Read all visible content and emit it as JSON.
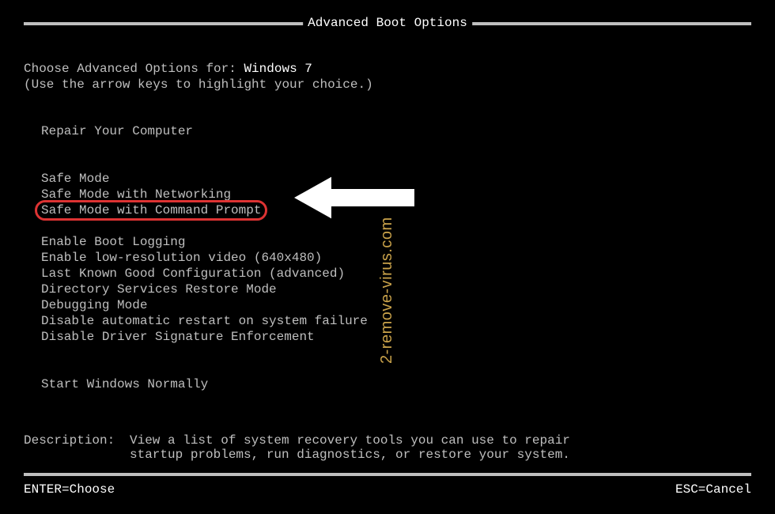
{
  "title": "Advanced Boot Options",
  "choose": {
    "label": "Choose Advanced Options for: ",
    "value": "Windows 7"
  },
  "hint": "(Use the arrow keys to highlight your choice.)",
  "menu": {
    "repair": "Repair Your Computer",
    "group1": {
      "safe_mode": "Safe Mode",
      "safe_net": "Safe Mode with Networking",
      "safe_cmd": "Safe Mode with Command Prompt"
    },
    "group2": {
      "boot_log": "Enable Boot Logging",
      "low_res": "Enable low-resolution video (640x480)",
      "lkgc": "Last Known Good Configuration (advanced)",
      "dsrm": "Directory Services Restore Mode",
      "debug": "Debugging Mode",
      "no_auto_restart": "Disable automatic restart on system failure",
      "no_driver_sig": "Disable Driver Signature Enforcement"
    },
    "start_normal": "Start Windows Normally"
  },
  "selected_item": "safe_cmd",
  "description": {
    "label": "Description:",
    "text": "View a list of system recovery tools you can use to repair\nstartup problems, run diagnostics, or restore your system."
  },
  "footer": {
    "enter": "ENTER=Choose",
    "esc": "ESC=Cancel"
  },
  "watermark": "2-remove-virus.com",
  "annotation": {
    "highlight_color": "#d33",
    "arrow_color": "#ffffff"
  }
}
